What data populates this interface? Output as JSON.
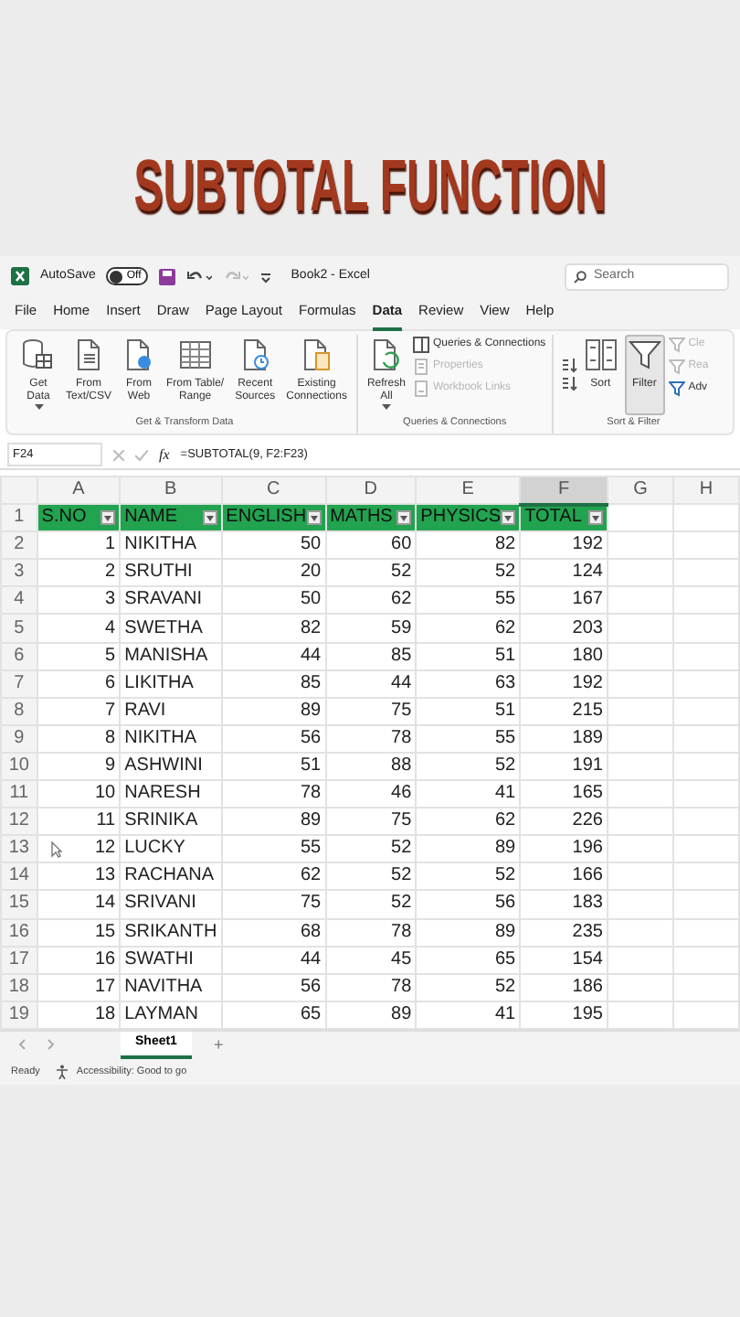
{
  "heading": "SUBTOTAL FUNCTION",
  "title_bar": {
    "autosave_label": "AutoSave",
    "autosave": {
      "label": "Off",
      "on": false
    },
    "document_title": "Book2 - Excel",
    "search": {
      "placeholder": "Search"
    }
  },
  "menu_tabs": [
    {
      "label": "File",
      "selected": false
    },
    {
      "label": "Home",
      "selected": false
    },
    {
      "label": "Insert",
      "selected": false
    },
    {
      "label": "Draw",
      "selected": false
    },
    {
      "label": "Page Layout",
      "selected": false
    },
    {
      "label": "Formulas",
      "selected": false
    },
    {
      "label": "Data",
      "selected": true
    },
    {
      "label": "Review",
      "selected": false
    },
    {
      "label": "View",
      "selected": false
    },
    {
      "label": "Help",
      "selected": false
    }
  ],
  "ribbon_groups": [
    {
      "label": "Get & Transform Data",
      "items": [
        {
          "kind": "large",
          "label": "Get\nData",
          "dropdown": true,
          "pressed": false
        },
        {
          "kind": "large",
          "label": "From\nText/CSV",
          "dropdown": false,
          "pressed": false
        },
        {
          "kind": "large",
          "label": "From\nWeb",
          "dropdown": false,
          "pressed": false
        },
        {
          "kind": "large",
          "label": "From Table/\nRange",
          "dropdown": false,
          "pressed": false
        },
        {
          "kind": "large",
          "label": "Recent\nSources",
          "dropdown": false,
          "pressed": false
        },
        {
          "kind": "large",
          "label": "Existing\nConnections",
          "dropdown": false,
          "pressed": false
        }
      ]
    },
    {
      "label": "Queries & Connections",
      "items": [
        {
          "kind": "large",
          "label": "Refresh\nAll",
          "dropdown": true,
          "pressed": false
        },
        {
          "kind": "small",
          "label": "Queries & Connections",
          "disabled": false
        },
        {
          "kind": "small",
          "label": "Properties",
          "disabled": true
        },
        {
          "kind": "small",
          "label": "Workbook Links",
          "disabled": true
        }
      ]
    },
    {
      "label": "Sort & Filter",
      "items": [
        {
          "kind": "sort_icons"
        },
        {
          "kind": "large",
          "label": "Sort",
          "dropdown": false,
          "pressed": false
        },
        {
          "kind": "large",
          "label": "Filter",
          "dropdown": false,
          "pressed": true
        },
        {
          "kind": "small",
          "label": "Cle",
          "disabled": true
        },
        {
          "kind": "small",
          "label": "Rea",
          "disabled": true
        },
        {
          "kind": "small",
          "label": "Adv",
          "disabled": false
        }
      ]
    }
  ],
  "formula_bar": {
    "name_box": "F24",
    "function_label": "fx",
    "formula": "=SUBTOTAL(9, F2:F23)"
  },
  "sheet": {
    "columns": [
      {
        "label": "A",
        "selected": false
      },
      {
        "label": "B",
        "selected": false
      },
      {
        "label": "C",
        "selected": false
      },
      {
        "label": "D",
        "selected": false
      },
      {
        "label": "E",
        "selected": false
      },
      {
        "label": "F",
        "selected": true
      },
      {
        "label": "G",
        "selected": false
      },
      {
        "label": "H",
        "selected": false
      }
    ],
    "header_row": {
      "number": "1",
      "headings": [
        "S.NO",
        "NAME",
        "ENGLISH",
        "MATHS",
        "PHYSICS",
        "TOTAL"
      ]
    },
    "rows": [
      {
        "number": "2",
        "cells": [
          "1",
          "NIKITHA",
          "50",
          "60",
          "82",
          "192"
        ]
      },
      {
        "number": "3",
        "cells": [
          "2",
          "SRUTHI",
          "20",
          "52",
          "52",
          "124"
        ]
      },
      {
        "number": "4",
        "cells": [
          "3",
          "SRAVANI",
          "50",
          "62",
          "55",
          "167"
        ]
      },
      {
        "number": "5",
        "cells": [
          "4",
          "SWETHA",
          "82",
          "59",
          "62",
          "203"
        ]
      },
      {
        "number": "6",
        "cells": [
          "5",
          "MANISHA",
          "44",
          "85",
          "51",
          "180"
        ]
      },
      {
        "number": "7",
        "cells": [
          "6",
          "LIKITHA",
          "85",
          "44",
          "63",
          "192"
        ]
      },
      {
        "number": "8",
        "cells": [
          "7",
          "RAVI",
          "89",
          "75",
          "51",
          "215"
        ]
      },
      {
        "number": "9",
        "cells": [
          "8",
          "NIKITHA",
          "56",
          "78",
          "55",
          "189"
        ]
      },
      {
        "number": "10",
        "cells": [
          "9",
          "ASHWINI",
          "51",
          "88",
          "52",
          "191"
        ]
      },
      {
        "number": "11",
        "cells": [
          "10",
          "NARESH",
          "78",
          "46",
          "41",
          "165"
        ]
      },
      {
        "number": "12",
        "cells": [
          "11",
          "SRINIKA",
          "89",
          "75",
          "62",
          "226"
        ]
      },
      {
        "number": "13",
        "cells": [
          "12",
          "LUCKY",
          "55",
          "52",
          "89",
          "196"
        ]
      },
      {
        "number": "14",
        "cells": [
          "13",
          "RACHANA",
          "62",
          "52",
          "52",
          "166"
        ]
      },
      {
        "number": "15",
        "cells": [
          "14",
          "SRIVANI",
          "75",
          "52",
          "56",
          "183"
        ]
      },
      {
        "number": "16",
        "cells": [
          "15",
          "SRIKANTH",
          "68",
          "78",
          "89",
          "235"
        ]
      },
      {
        "number": "17",
        "cells": [
          "16",
          "SWATHI",
          "44",
          "45",
          "65",
          "154"
        ]
      },
      {
        "number": "18",
        "cells": [
          "17",
          "NAVITHA",
          "56",
          "78",
          "52",
          "186"
        ]
      },
      {
        "number": "19",
        "cells": [
          "18",
          "LAYMAN",
          "65",
          "89",
          "41",
          "195"
        ]
      }
    ]
  },
  "sheet_tabs": [
    {
      "label": "Sheet1",
      "selected": true
    }
  ],
  "add_sheet": "+",
  "status_bar": {
    "mode": "Ready",
    "accessibility": "Accessibility: Good to go"
  }
}
